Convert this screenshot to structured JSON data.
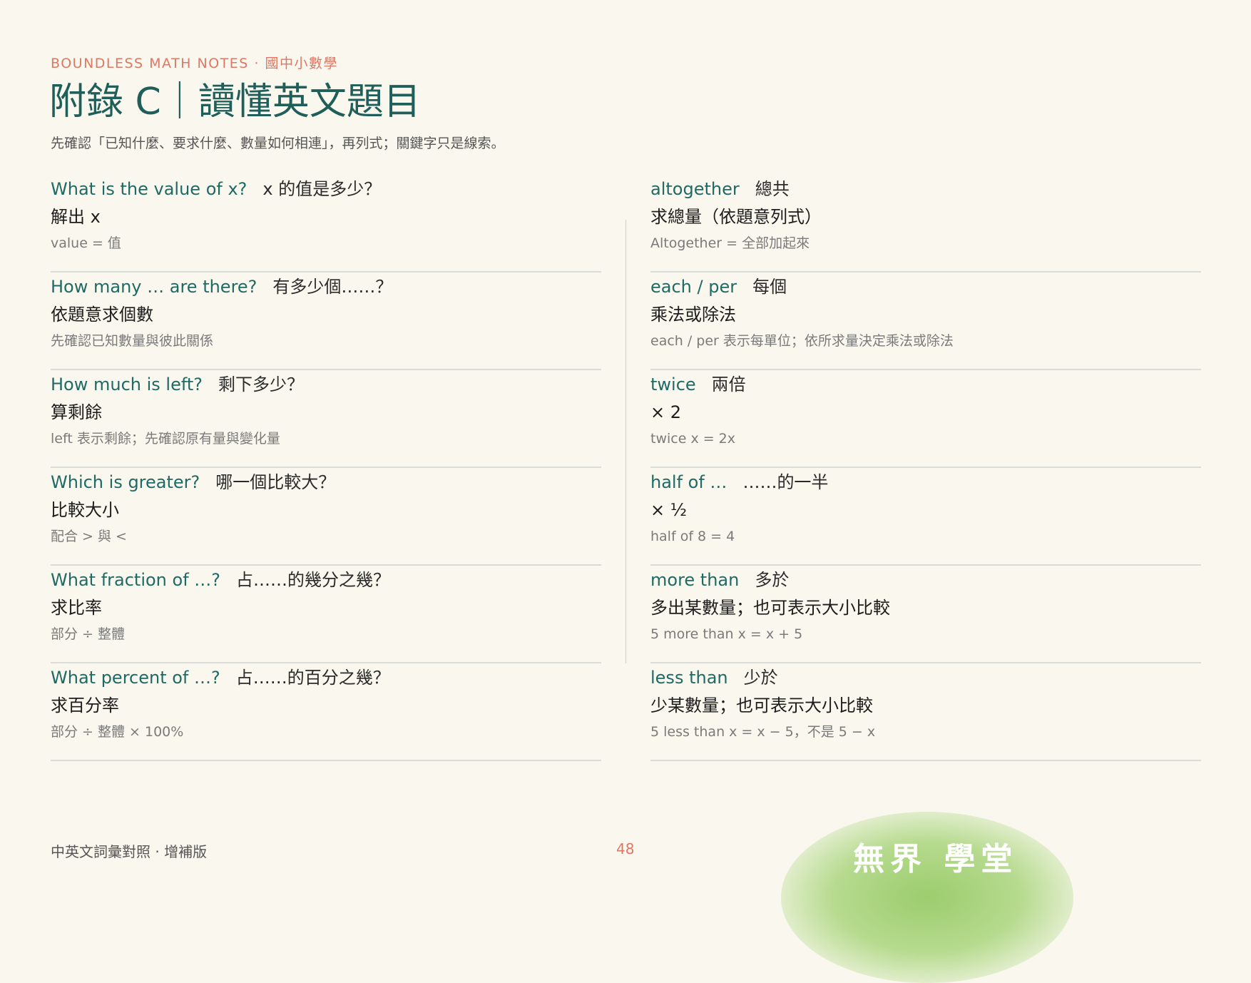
{
  "header": {
    "kicker": "BOUNDLESS MATH NOTES · 國中小數學",
    "title": "附錄 C｜讀懂英文題目",
    "subtitle": "先確認「已知什麼、要求什麼、數量如何相連」，再列式；關鍵字只是線索。"
  },
  "left_entries": [
    {
      "en": "What is the value of x?",
      "zh": "x 的值是多少？",
      "meaning": "解出 x",
      "note": "value = 值"
    },
    {
      "en": "How many … are there?",
      "zh": "有多少個……？",
      "meaning": "依題意求個數",
      "note": "先確認已知數量與彼此關係"
    },
    {
      "en": "How much is left?",
      "zh": "剩下多少？",
      "meaning": "算剩餘",
      "note": "left 表示剩餘；先確認原有量與變化量"
    },
    {
      "en": "Which is greater?",
      "zh": "哪一個比較大？",
      "meaning": "比較大小",
      "note": "配合 > 與 <"
    },
    {
      "en": "What fraction of …?",
      "zh": "占……的幾分之幾？",
      "meaning": "求比率",
      "note": "部分 ÷ 整體"
    },
    {
      "en": "What percent of …?",
      "zh": "占……的百分之幾？",
      "meaning": "求百分率",
      "note": "部分 ÷ 整體 × 100%"
    }
  ],
  "right_entries": [
    {
      "en": "altogether",
      "zh": "總共",
      "meaning": "求總量（依題意列式）",
      "note": "Altogether = 全部加起來"
    },
    {
      "en": "each / per",
      "zh": "每個",
      "meaning": "乘法或除法",
      "note": "each / per 表示每單位；依所求量決定乘法或除法"
    },
    {
      "en": "twice",
      "zh": "兩倍",
      "meaning": "× 2",
      "note": "twice x = 2x"
    },
    {
      "en": "half of …",
      "zh": "……的一半",
      "meaning": "× ½",
      "note": "half of 8 = 4"
    },
    {
      "en": "more than",
      "zh": "多於",
      "meaning": "多出某數量；也可表示大小比較",
      "note": "5 more than x = x + 5"
    },
    {
      "en": "less than",
      "zh": "少於",
      "meaning": "少某數量；也可表示大小比較",
      "note": "5 less than x = x − 5，不是 5 − x"
    }
  ],
  "footer": {
    "left_text": "中英文詞彙對照 · 增補版",
    "page_number": "48",
    "logo_text": "無界 學堂"
  }
}
